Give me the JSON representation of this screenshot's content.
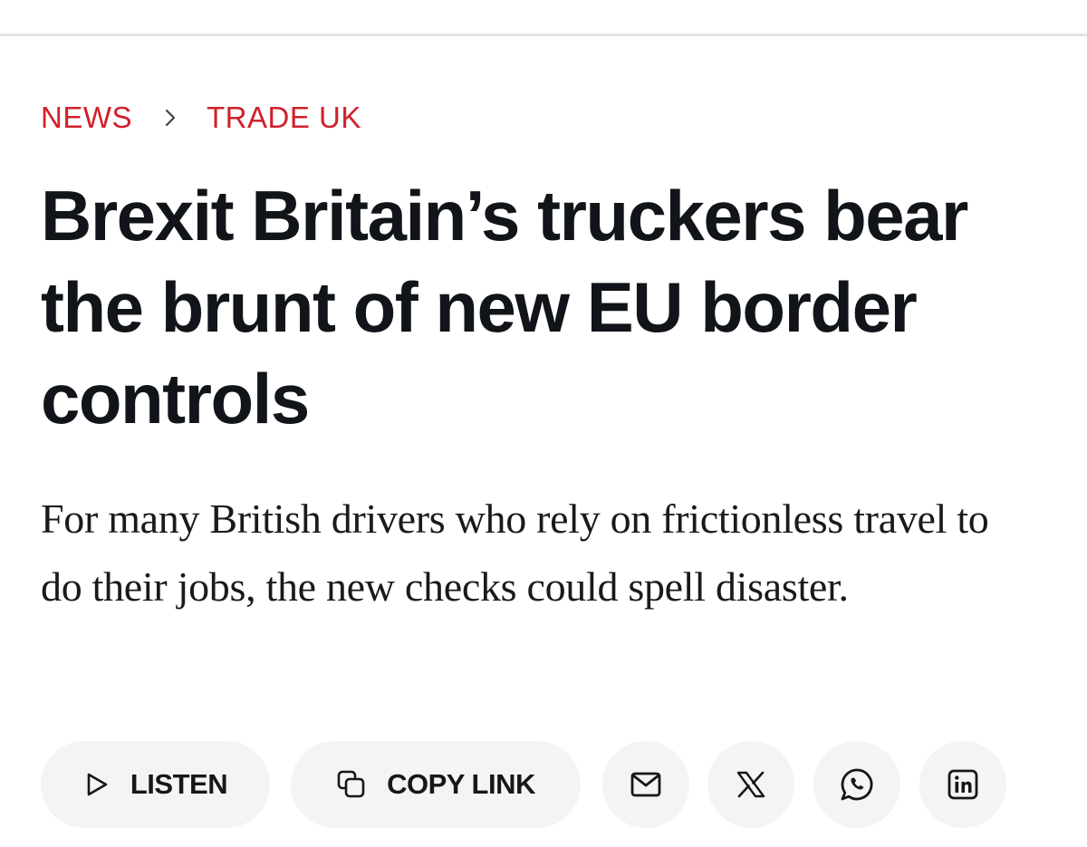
{
  "breadcrumb": {
    "section": "NEWS",
    "subsection": "TRADE UK"
  },
  "article": {
    "headline": "Brexit Britain’s truckers bear the brunt of new EU border controls",
    "standfirst": "For many British drivers who rely on frictionless travel to do their jobs, the new checks could spell disaster."
  },
  "actions": {
    "listen_label": "LISTEN",
    "copy_link_label": "COPY LINK",
    "share_icons": [
      "email-icon",
      "x-icon",
      "whatsapp-icon",
      "linkedin-icon"
    ]
  },
  "colors": {
    "accent": "#d0202a",
    "text": "#111418",
    "button_bg": "#f4f4f4",
    "rule": "#e4e4e4"
  }
}
